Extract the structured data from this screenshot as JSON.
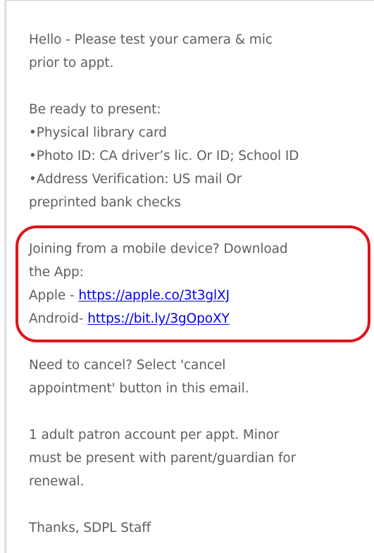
{
  "message": {
    "greeting": [
      "Hello - Please test your camera & mic",
      "prior to appt."
    ],
    "requirements": {
      "heading": "Be ready to present:",
      "items": [
        "•Physical library card",
        "•Photo ID: CA driver’s lic. Or ID; School ID",
        "•Address Verification: US mail Or",
        "preprinted bank checks"
      ]
    },
    "mobile": {
      "lines": [
        "Joining from a mobile device? Download",
        "the App:"
      ],
      "apple_label": "Apple - ",
      "apple_link": "https://apple.co/3t3glXJ",
      "android_label": "Android- ",
      "android_link": "https://bit.ly/3gOpoXY"
    },
    "cancel": [
      "Need to cancel? Select 'cancel",
      "appointment' button in this email."
    ],
    "policy": [
      "1 adult patron account per appt. Minor",
      "must be present with parent/guardian for",
      "renewal."
    ],
    "signoff": "Thanks, SDPL Staff"
  },
  "colors": {
    "text": "#5f5f5f",
    "link": "#0000ee",
    "highlight": "#e0131d"
  }
}
